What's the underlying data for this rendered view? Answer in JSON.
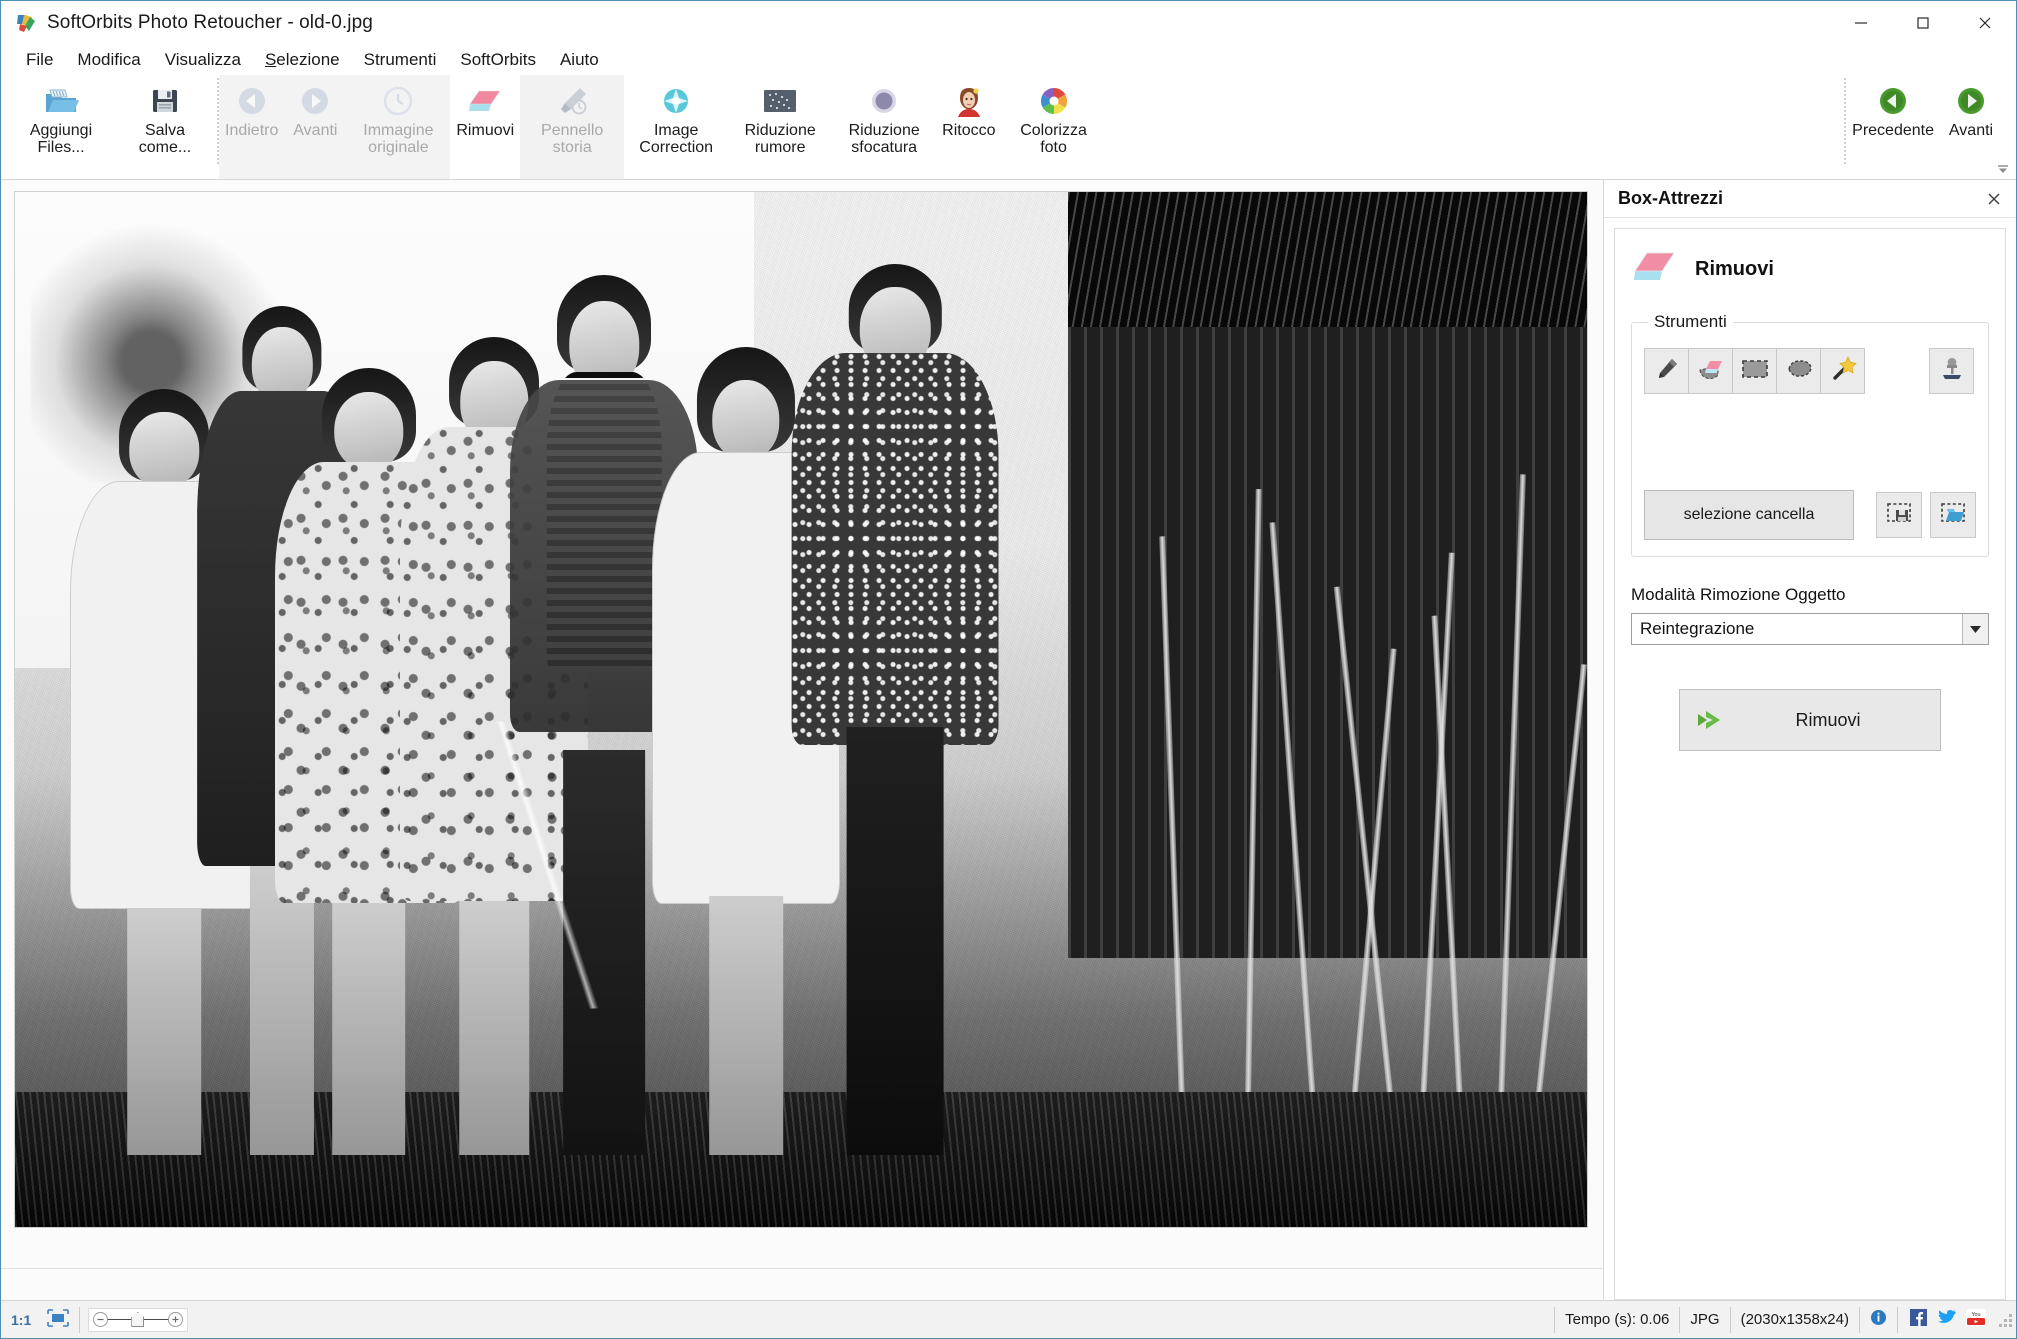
{
  "window": {
    "title": "SoftOrbits Photo Retoucher - old-0.jpg",
    "app_icon": "softorbits-logo-icon",
    "minimize_label": "minimize-icon",
    "maximize_label": "maximize-icon",
    "close_label": "close-icon"
  },
  "menu": {
    "items": [
      {
        "label": "File"
      },
      {
        "label": "Modifica"
      },
      {
        "label": "Visualizza"
      },
      {
        "label": "Selezione",
        "accel": "S"
      },
      {
        "label": "Strumenti"
      },
      {
        "label": "SoftOrbits"
      },
      {
        "label": "Aiuto"
      }
    ]
  },
  "ribbon": {
    "buttons": [
      {
        "id": "add-files",
        "label": "Aggiungi Files...",
        "icon": "open-folder-icon",
        "disabled": false,
        "highlighted": false
      },
      {
        "id": "save-as",
        "label": "Salva come...",
        "icon": "floppy-save-icon",
        "disabled": false,
        "highlighted": false
      },
      {
        "id": "undo",
        "label": "Indietro",
        "icon": "undo-arrow-icon",
        "disabled": true,
        "highlighted": false
      },
      {
        "id": "redo",
        "label": "Avanti",
        "icon": "redo-arrow-icon",
        "disabled": true,
        "highlighted": false
      },
      {
        "id": "original-image",
        "label": "Immagine originale",
        "icon": "clock-history-icon",
        "disabled": true,
        "highlighted": false
      },
      {
        "id": "remove",
        "label": "Rimuovi",
        "icon": "eraser-icon",
        "disabled": false,
        "highlighted": false
      },
      {
        "id": "history-brush",
        "label": "Pennello storia",
        "icon": "history-brush-icon",
        "disabled": true,
        "highlighted": true
      },
      {
        "id": "image-correction",
        "label": "Image Correction",
        "icon": "gem-sparkle-icon",
        "disabled": false,
        "highlighted": false
      },
      {
        "id": "noise-reduction",
        "label": "Riduzione rumore",
        "icon": "noise-square-icon",
        "disabled": false,
        "highlighted": false
      },
      {
        "id": "blur-reduction",
        "label": "Riduzione sfocatura",
        "icon": "blur-circle-icon",
        "disabled": false,
        "highlighted": false
      },
      {
        "id": "retouch",
        "label": "Ritocco",
        "icon": "portrait-retouch-icon",
        "disabled": false,
        "highlighted": false
      },
      {
        "id": "colorize-photo",
        "label": "Colorizza foto",
        "icon": "color-wheel-icon",
        "disabled": false,
        "highlighted": false
      }
    ],
    "nav": [
      {
        "id": "previous",
        "label": "Precedente",
        "icon": "green-left-arrow-icon"
      },
      {
        "id": "next",
        "label": "Avanti",
        "icon": "green-right-arrow-icon"
      }
    ],
    "expand_icon": "chevron-down-icon"
  },
  "panel": {
    "title": "Box-Attrezzi",
    "close_icon": "close-icon",
    "tool": {
      "name": "Rimuovi",
      "icon": "eraser-icon"
    },
    "tools_group": {
      "legend": "Strumenti",
      "buttons": [
        {
          "id": "pencil",
          "icon": "pencil-icon"
        },
        {
          "id": "eraser-select",
          "icon": "eraser-selection-icon"
        },
        {
          "id": "rect-select",
          "icon": "rectangle-select-icon"
        },
        {
          "id": "lasso-select",
          "icon": "lasso-select-icon"
        },
        {
          "id": "magic-wand",
          "icon": "magic-wand-icon"
        },
        {
          "id": "stamp",
          "icon": "clone-stamp-icon"
        }
      ],
      "clear_button": "selezione cancella",
      "extra_buttons": [
        {
          "id": "save-selection",
          "icon": "save-selection-icon"
        },
        {
          "id": "load-selection",
          "icon": "load-selection-icon"
        }
      ]
    },
    "mode": {
      "label": "Modalità Rimozione Oggetto",
      "value": "Reintegrazione",
      "arrow_icon": "chevron-down-icon"
    },
    "apply": {
      "label": "Rimuovi",
      "icon": "green-double-arrow-icon"
    }
  },
  "statusbar": {
    "zoom_ratio": "1:1",
    "fit_icon": "fit-to-screen-icon",
    "zoom_out_icon": "minus-icon",
    "zoom_in_icon": "plus-icon",
    "time": "Tempo (s): 0.06",
    "format": "JPG",
    "dimensions": "(2030x1358x24)",
    "info_icon": "info-icon",
    "facebook_icon": "facebook-icon",
    "twitter_icon": "twitter-icon",
    "youtube_icon": "youtube-icon"
  },
  "colors": {
    "accent_blue": "#4f8fb5",
    "green": "#4a9b2f",
    "eraser_pink": "#f2889f",
    "eraser_blue": "#9fd8ea"
  }
}
